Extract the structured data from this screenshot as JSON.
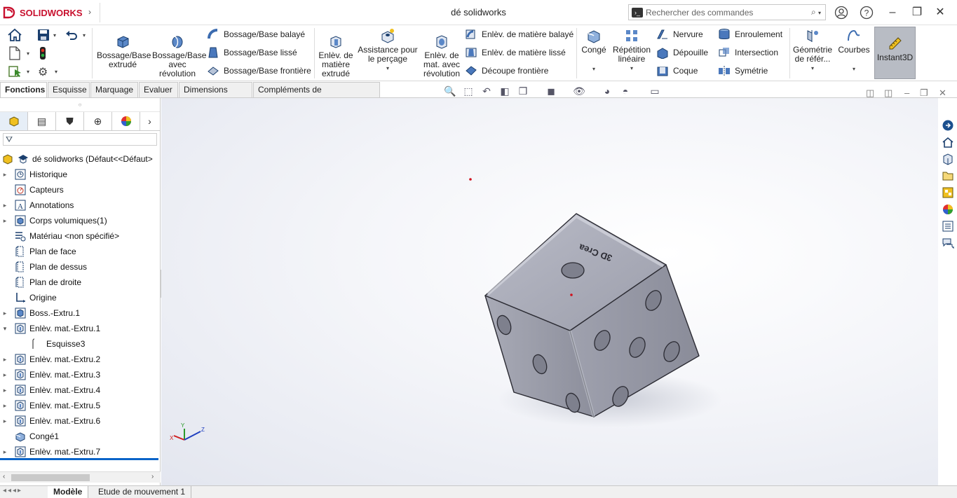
{
  "app": {
    "brand": "SOLIDWORKS",
    "document_title": "dé solidworks"
  },
  "search": {
    "placeholder": "Rechercher des commandes"
  },
  "ribbon": {
    "boss_extrude": "Bossage/Base extrudé",
    "boss_revolve": "Bossage/Base avec révolution",
    "swept_boss": "Bossage/Base balayé",
    "lofted_boss": "Bossage/Base lissé",
    "boundary_boss": "Bossage/Base frontière",
    "cut_extrude": "Enlèv. de matière extrudé",
    "hole_wizard": "Assistance pour le perçage",
    "cut_revolve": "Enlèv. de mat. avec révolution",
    "swept_cut": "Enlèv. de matière balayé",
    "lofted_cut": "Enlèv. de matière lissé",
    "boundary_cut": "Découpe frontière",
    "fillet": "Congé",
    "linear_pattern": "Répétition linéaire",
    "rib": "Nervure",
    "draft": "Dépouille",
    "shell": "Coque",
    "wrap": "Enroulement",
    "intersect": "Intersection",
    "mirror": "Symétrie",
    "ref_geometry": "Géométrie de référ...",
    "curves": "Courbes",
    "instant3d": "Instant3D"
  },
  "tabs": [
    "Fonctions",
    "Esquisse",
    "Marquage",
    "Evaluer",
    "Dimensions MBD",
    "Compléments de SOLIDWORKS"
  ],
  "tree": {
    "root": "dé solidworks  (Défaut<<Défaut>",
    "items": [
      {
        "label": "Historique",
        "icon": "history-icon",
        "exp": "›"
      },
      {
        "label": "Capteurs",
        "icon": "sensor-icon",
        "exp": ""
      },
      {
        "label": "Annotations",
        "icon": "annotation-icon",
        "exp": "›"
      },
      {
        "label": "Corps volumiques(1)",
        "icon": "solid-body-icon",
        "exp": "›"
      },
      {
        "label": "Matériau <non spécifié>",
        "icon": "material-icon",
        "exp": ""
      },
      {
        "label": "Plan de face",
        "icon": "plane-icon",
        "exp": ""
      },
      {
        "label": "Plan de dessus",
        "icon": "plane-icon",
        "exp": ""
      },
      {
        "label": "Plan de droite",
        "icon": "plane-icon",
        "exp": ""
      },
      {
        "label": "Origine",
        "icon": "origin-icon",
        "exp": ""
      },
      {
        "label": "Boss.-Extru.1",
        "icon": "extrude-icon",
        "exp": "›"
      },
      {
        "label": "Enlèv. mat.-Extru.1",
        "icon": "cut-icon",
        "exp": "⌄"
      },
      {
        "label": "Esquisse3",
        "icon": "sketch-icon",
        "exp": "",
        "child": true
      },
      {
        "label": "Enlèv. mat.-Extru.2",
        "icon": "cut-icon",
        "exp": "›"
      },
      {
        "label": "Enlèv. mat.-Extru.3",
        "icon": "cut-icon",
        "exp": "›"
      },
      {
        "label": "Enlèv. mat.-Extru.4",
        "icon": "cut-icon",
        "exp": "›"
      },
      {
        "label": "Enlèv. mat.-Extru.5",
        "icon": "cut-icon",
        "exp": "›"
      },
      {
        "label": "Enlèv. mat.-Extru.6",
        "icon": "cut-icon",
        "exp": "›"
      },
      {
        "label": "Congé1",
        "icon": "fillet-icon",
        "exp": ""
      },
      {
        "label": "Enlèv. mat.-Extru.7",
        "icon": "cut-icon",
        "exp": "›"
      }
    ]
  },
  "bottom_tabs": [
    "Modèle",
    "Etude de mouvement 1"
  ],
  "model": {
    "engraving": "3D Crea"
  },
  "colors": {
    "accent": "#c8102e",
    "part": "#9ea0ad",
    "selection": "#0a64c8"
  }
}
